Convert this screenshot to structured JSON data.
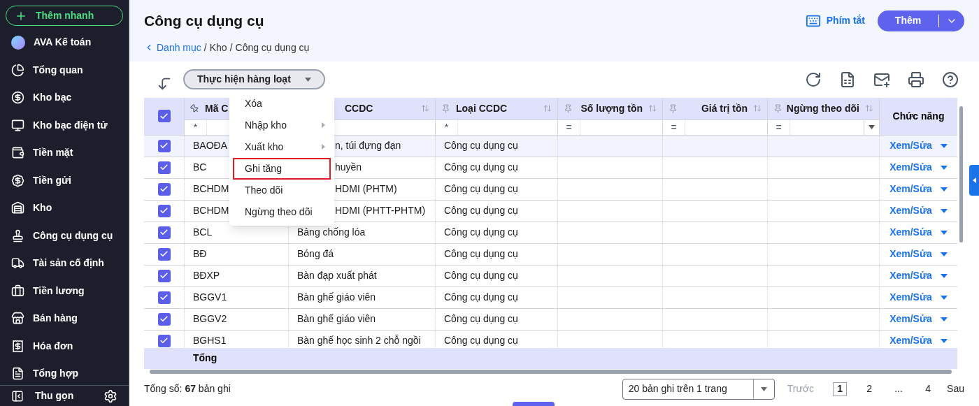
{
  "sidebar": {
    "quick_add": "Thêm nhanh",
    "items": [
      {
        "label": "AVA Kế toán",
        "kind": "avatar"
      },
      {
        "label": "Tổng quan",
        "kind": "pie"
      },
      {
        "label": "Kho bạc",
        "kind": "bank"
      },
      {
        "label": "Kho bạc điện tử",
        "kind": "ebank"
      },
      {
        "label": "Tiền mặt",
        "kind": "cash"
      },
      {
        "label": "Tiền gửi",
        "kind": "deposit"
      },
      {
        "label": "Kho",
        "kind": "warehouse"
      },
      {
        "label": "Công cụ dụng cụ",
        "kind": "tools"
      },
      {
        "label": "Tài sản cố định",
        "kind": "truck"
      },
      {
        "label": "Tiền lương",
        "kind": "salary"
      },
      {
        "label": "Bán hàng",
        "kind": "store"
      },
      {
        "label": "Hóa đơn",
        "kind": "invoice"
      },
      {
        "label": "Tổng hợp",
        "kind": "report"
      }
    ],
    "collapse": "Thu gọn"
  },
  "header": {
    "title": "Công cụ dụng cụ",
    "shortcuts": "Phím tắt",
    "add": "Thêm",
    "breadcrumb": [
      {
        "label": "Danh mục",
        "link": true
      },
      {
        "label": "/",
        "link": false
      },
      {
        "label": "Kho",
        "link": false
      },
      {
        "label": "/",
        "link": false
      },
      {
        "label": "Công cụ dụng cụ",
        "link": false
      }
    ]
  },
  "batch": {
    "label": "Thực hiện hàng loạt",
    "open": true,
    "menu": [
      {
        "label": "Xóa",
        "submenu": false,
        "highlighted": false
      },
      {
        "label": "Nhập kho",
        "submenu": true,
        "highlighted": false
      },
      {
        "label": "Xuất kho",
        "submenu": true,
        "highlighted": false
      },
      {
        "label": "Ghi tăng",
        "submenu": false,
        "highlighted": true
      },
      {
        "label": "Theo dõi",
        "submenu": false,
        "highlighted": false
      },
      {
        "label": "Ngừng theo dõi",
        "submenu": false,
        "highlighted": false
      }
    ]
  },
  "table": {
    "all_checked": true,
    "columns": [
      {
        "label": "Mã C",
        "pinned": true,
        "filter": "*",
        "kind": "text"
      },
      {
        "label": "CCDC",
        "kind": "text"
      },
      {
        "label": "Loại CCDC",
        "pinned": false,
        "filter": "*",
        "kind": "text"
      },
      {
        "label": "Số lượng tồn",
        "pinned": false,
        "filter": "=",
        "kind": "number"
      },
      {
        "label": "Giá trị tồn",
        "pinned": false,
        "filter": "=",
        "kind": "number"
      },
      {
        "label": "Ngừng theo dõi",
        "pinned": false,
        "filter": "=",
        "kind": "number",
        "dropdown": true
      }
    ],
    "action_column": "Chức năng",
    "rows": [
      {
        "checked": true,
        "selected": true,
        "cells": [
          "BAOĐA",
          "n, túi đựng đạn",
          "Công cụ dụng cụ"
        ],
        "action": "Xem/Sửa"
      },
      {
        "checked": true,
        "selected": false,
        "cells": [
          "BC",
          "huyền",
          "Công cụ dụng cụ"
        ],
        "action": "Xem/Sửa"
      },
      {
        "checked": true,
        "selected": false,
        "cells": [
          "BCHDM",
          "HDMI (PHTM)",
          "Công cụ dụng cụ"
        ],
        "action": "Xem/Sửa"
      },
      {
        "checked": true,
        "selected": false,
        "cells": [
          "BCHDM",
          "HDMI (PHTT-PHTM)",
          "Công cụ dụng cụ"
        ],
        "action": "Xem/Sửa"
      },
      {
        "checked": true,
        "selected": false,
        "cells": [
          "BCL",
          "Bảng chống lóa",
          "Công cụ dụng cụ"
        ],
        "action": "Xem/Sửa"
      },
      {
        "checked": true,
        "selected": false,
        "cells": [
          "BĐ",
          "Bóng đá",
          "Công cụ dụng cụ"
        ],
        "action": "Xem/Sửa"
      },
      {
        "checked": true,
        "selected": false,
        "cells": [
          "BĐXP",
          "Bàn đạp xuất phát",
          "Công cụ dụng cụ"
        ],
        "action": "Xem/Sửa"
      },
      {
        "checked": true,
        "selected": false,
        "cells": [
          "BGGV1",
          "Bàn ghế giáo viên",
          "Công cụ dụng cụ"
        ],
        "action": "Xem/Sửa"
      },
      {
        "checked": true,
        "selected": false,
        "cells": [
          "BGGV2",
          "Bàn ghế giáo viên",
          "Công cụ dụng cụ"
        ],
        "action": "Xem/Sửa"
      },
      {
        "checked": true,
        "selected": false,
        "cells": [
          "BGHS1",
          "Bàn ghế học sinh 2 chỗ ngồi",
          "Công cụ dụng cụ"
        ],
        "action": "Xem/Sửa"
      }
    ],
    "total_label": "Tổng"
  },
  "footer": {
    "summary": "Tổng số: **67** bản ghi",
    "page_size": "20 bản ghi trên 1 trang",
    "prev": {
      "label": "Trước",
      "disabled": true
    },
    "pages": [
      {
        "label": "1",
        "selected": true
      },
      {
        "label": "2",
        "selected": false
      },
      {
        "label": "...",
        "selected": false
      },
      {
        "label": "4",
        "selected": false
      }
    ],
    "next": {
      "label": "Sau",
      "disabled": false
    }
  }
}
